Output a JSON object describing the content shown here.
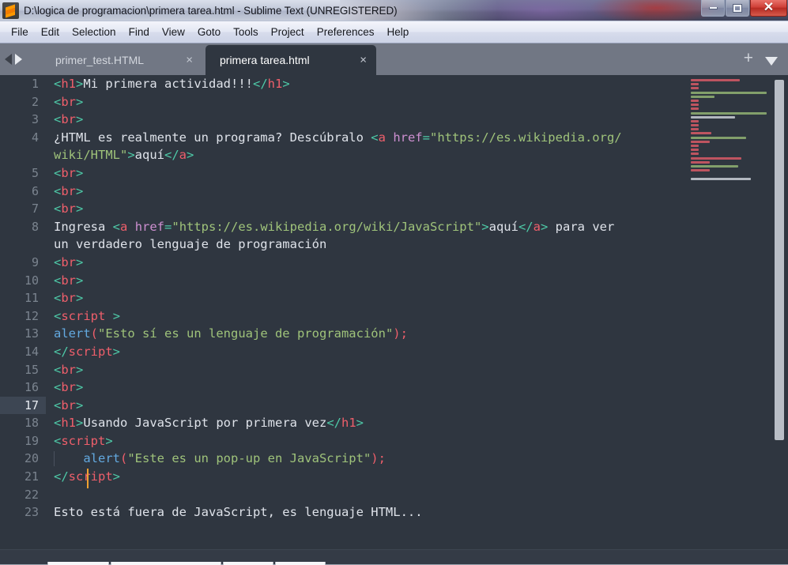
{
  "window": {
    "title": "D:\\logica de programacion\\primera tarea.html - Sublime Text (UNREGISTERED)",
    "app_icon": "sublime-text-logo",
    "minimize_label": "–",
    "maximize_label": "□",
    "close_label": "✕"
  },
  "menubar": {
    "items": [
      {
        "label": "File"
      },
      {
        "label": "Edit"
      },
      {
        "label": "Selection"
      },
      {
        "label": "Find"
      },
      {
        "label": "View"
      },
      {
        "label": "Goto"
      },
      {
        "label": "Tools"
      },
      {
        "label": "Project"
      },
      {
        "label": "Preferences"
      },
      {
        "label": "Help"
      }
    ]
  },
  "tabbar": {
    "nav_prev_icon": "chevron-left-icon",
    "nav_next_icon": "chevron-right-icon",
    "add_tab_label": "+",
    "tab_menu_icon": "chevron-down-icon",
    "close_icon": "×",
    "tabs": [
      {
        "label": "primer_test.HTML",
        "active": false
      },
      {
        "label": "primera tarea.html",
        "active": true
      }
    ]
  },
  "editor": {
    "active_line": 17,
    "cursor": {
      "line": 17,
      "column": 5
    },
    "colors": {
      "background": "#2f3640",
      "gutter_text": "#7b848f",
      "active_line_gutter_bg": "#3d4653",
      "punctuation": "#4ec9a7",
      "tag": "#ef5f6b",
      "attribute": "#cd8fd0",
      "string": "#9fc37a",
      "plain_text": "#dfe3ea",
      "function": "#63a9e0",
      "cursor": "#f0a030",
      "scrollbar_thumb": "#b9bec6"
    },
    "lines": [
      {
        "num": "1",
        "tokens": [
          {
            "t": "punct",
            "v": "<"
          },
          {
            "t": "tag",
            "v": "h1"
          },
          {
            "t": "punct",
            "v": ">"
          },
          {
            "t": "plain",
            "v": "Mi primera actividad!!!"
          },
          {
            "t": "punct",
            "v": "</"
          },
          {
            "t": "tag",
            "v": "h1"
          },
          {
            "t": "punct",
            "v": ">"
          }
        ]
      },
      {
        "num": "2",
        "tokens": [
          {
            "t": "punct",
            "v": "<"
          },
          {
            "t": "tag",
            "v": "br"
          },
          {
            "t": "punct",
            "v": ">"
          }
        ]
      },
      {
        "num": "3",
        "tokens": [
          {
            "t": "punct",
            "v": "<"
          },
          {
            "t": "tag",
            "v": "br"
          },
          {
            "t": "punct",
            "v": ">"
          }
        ]
      },
      {
        "num": "4",
        "tokens": [
          {
            "t": "plain",
            "v": "¿HTML es realmente un programa? Descúbralo "
          },
          {
            "t": "punct",
            "v": "<"
          },
          {
            "t": "tag",
            "v": "a"
          },
          {
            "t": "plain",
            "v": " "
          },
          {
            "t": "attr",
            "v": "href"
          },
          {
            "t": "punct",
            "v": "="
          },
          {
            "t": "str",
            "v": "\"https://es.wikipedia.org/"
          }
        ]
      },
      {
        "num": "",
        "wrap": true,
        "tokens": [
          {
            "t": "str",
            "v": "wiki/HTML\""
          },
          {
            "t": "punct",
            "v": ">"
          },
          {
            "t": "plain",
            "v": "aquí"
          },
          {
            "t": "punct",
            "v": "</"
          },
          {
            "t": "tag",
            "v": "a"
          },
          {
            "t": "punct",
            "v": ">"
          }
        ]
      },
      {
        "num": "5",
        "tokens": [
          {
            "t": "punct",
            "v": "<"
          },
          {
            "t": "tag",
            "v": "br"
          },
          {
            "t": "punct",
            "v": ">"
          }
        ]
      },
      {
        "num": "6",
        "tokens": [
          {
            "t": "punct",
            "v": "<"
          },
          {
            "t": "tag",
            "v": "br"
          },
          {
            "t": "punct",
            "v": ">"
          }
        ]
      },
      {
        "num": "7",
        "tokens": [
          {
            "t": "punct",
            "v": "<"
          },
          {
            "t": "tag",
            "v": "br"
          },
          {
            "t": "punct",
            "v": ">"
          }
        ]
      },
      {
        "num": "8",
        "tokens": [
          {
            "t": "plain",
            "v": "Ingresa "
          },
          {
            "t": "punct",
            "v": "<"
          },
          {
            "t": "tag",
            "v": "a"
          },
          {
            "t": "plain",
            "v": " "
          },
          {
            "t": "attr",
            "v": "href"
          },
          {
            "t": "punct",
            "v": "="
          },
          {
            "t": "str",
            "v": "\"https://es.wikipedia.org/wiki/JavaScript\""
          },
          {
            "t": "punct",
            "v": ">"
          },
          {
            "t": "plain",
            "v": "aquí"
          },
          {
            "t": "punct",
            "v": "</"
          },
          {
            "t": "tag",
            "v": "a"
          },
          {
            "t": "punct",
            "v": ">"
          },
          {
            "t": "plain",
            "v": " para ver"
          }
        ]
      },
      {
        "num": "",
        "wrap": true,
        "tokens": [
          {
            "t": "plain",
            "v": "un verdadero lenguaje de programación"
          }
        ]
      },
      {
        "num": "9",
        "tokens": [
          {
            "t": "punct",
            "v": "<"
          },
          {
            "t": "tag",
            "v": "br"
          },
          {
            "t": "punct",
            "v": ">"
          }
        ]
      },
      {
        "num": "10",
        "tokens": [
          {
            "t": "punct",
            "v": "<"
          },
          {
            "t": "tag",
            "v": "br"
          },
          {
            "t": "punct",
            "v": ">"
          }
        ]
      },
      {
        "num": "11",
        "tokens": [
          {
            "t": "punct",
            "v": "<"
          },
          {
            "t": "tag",
            "v": "br"
          },
          {
            "t": "punct",
            "v": ">"
          }
        ]
      },
      {
        "num": "12",
        "tokens": [
          {
            "t": "punct",
            "v": "<"
          },
          {
            "t": "tag",
            "v": "script"
          },
          {
            "t": "plain",
            "v": " "
          },
          {
            "t": "punct",
            "v": ">"
          }
        ]
      },
      {
        "num": "13",
        "tokens": [
          {
            "t": "fn",
            "v": "alert"
          },
          {
            "t": "paren",
            "v": "("
          },
          {
            "t": "str",
            "v": "\"Esto sí es un lenguaje de programación\""
          },
          {
            "t": "paren",
            "v": ");"
          }
        ]
      },
      {
        "num": "14",
        "tokens": [
          {
            "t": "punct",
            "v": "</"
          },
          {
            "t": "tag",
            "v": "script"
          },
          {
            "t": "punct",
            "v": ">"
          }
        ]
      },
      {
        "num": "15",
        "tokens": [
          {
            "t": "punct",
            "v": "<"
          },
          {
            "t": "tag",
            "v": "br"
          },
          {
            "t": "punct",
            "v": ">"
          }
        ]
      },
      {
        "num": "16",
        "tokens": [
          {
            "t": "punct",
            "v": "<"
          },
          {
            "t": "tag",
            "v": "br"
          },
          {
            "t": "punct",
            "v": ">"
          }
        ]
      },
      {
        "num": "17",
        "active": true,
        "tokens": [
          {
            "t": "punct",
            "v": "<"
          },
          {
            "t": "tag",
            "v": "br"
          },
          {
            "t": "punct",
            "v": ">"
          }
        ]
      },
      {
        "num": "18",
        "tokens": [
          {
            "t": "punct",
            "v": "<"
          },
          {
            "t": "tag",
            "v": "h1"
          },
          {
            "t": "punct",
            "v": ">"
          },
          {
            "t": "plain",
            "v": "Usando JavaScript por primera vez"
          },
          {
            "t": "punct",
            "v": "</"
          },
          {
            "t": "tag",
            "v": "h1"
          },
          {
            "t": "punct",
            "v": ">"
          }
        ]
      },
      {
        "num": "19",
        "tokens": [
          {
            "t": "punct",
            "v": "<"
          },
          {
            "t": "tag",
            "v": "script"
          },
          {
            "t": "punct",
            "v": ">"
          }
        ]
      },
      {
        "num": "20",
        "indent_guide": true,
        "tokens": [
          {
            "t": "plain",
            "v": "    "
          },
          {
            "t": "fn",
            "v": "alert"
          },
          {
            "t": "paren",
            "v": "("
          },
          {
            "t": "str",
            "v": "\"Este es un pop-up en JavaScript\""
          },
          {
            "t": "paren",
            "v": ");"
          }
        ]
      },
      {
        "num": "21",
        "tokens": [
          {
            "t": "punct",
            "v": "</"
          },
          {
            "t": "tag",
            "v": "script"
          },
          {
            "t": "punct",
            "v": ">"
          }
        ]
      },
      {
        "num": "22",
        "tokens": []
      },
      {
        "num": "23",
        "tokens": [
          {
            "t": "plain",
            "v": "Esto está fuera de JavaScript, es lenguaje HTML..."
          }
        ]
      }
    ]
  },
  "minimap": {
    "label": "code-minimap",
    "lines": [
      {
        "w": 62,
        "c": "#ef5f6b"
      },
      {
        "w": 10,
        "c": "#ef5f6b"
      },
      {
        "w": 10,
        "c": "#ef5f6b"
      },
      {
        "w": 96,
        "c": "#9fc37a"
      },
      {
        "w": 30,
        "c": "#9fc37a"
      },
      {
        "w": 10,
        "c": "#ef5f6b"
      },
      {
        "w": 10,
        "c": "#ef5f6b"
      },
      {
        "w": 10,
        "c": "#ef5f6b"
      },
      {
        "w": 96,
        "c": "#9fc37a"
      },
      {
        "w": 56,
        "c": "#dfe3ea"
      },
      {
        "w": 10,
        "c": "#ef5f6b"
      },
      {
        "w": 10,
        "c": "#ef5f6b"
      },
      {
        "w": 10,
        "c": "#ef5f6b"
      },
      {
        "w": 26,
        "c": "#ef5f6b"
      },
      {
        "w": 70,
        "c": "#9fc37a"
      },
      {
        "w": 24,
        "c": "#ef5f6b"
      },
      {
        "w": 10,
        "c": "#ef5f6b"
      },
      {
        "w": 10,
        "c": "#ef5f6b"
      },
      {
        "w": 10,
        "c": "#ef5f6b"
      },
      {
        "w": 64,
        "c": "#ef5f6b"
      },
      {
        "w": 24,
        "c": "#ef5f6b"
      },
      {
        "w": 60,
        "c": "#9fc37a"
      },
      {
        "w": 24,
        "c": "#ef5f6b"
      },
      {
        "w": 0,
        "c": "#2f3640"
      },
      {
        "w": 76,
        "c": "#dfe3ea"
      }
    ]
  },
  "scrollbar": {
    "name": "vertical-scrollbar",
    "thumb_top_pct": 1,
    "thumb_height_pct": 76
  }
}
